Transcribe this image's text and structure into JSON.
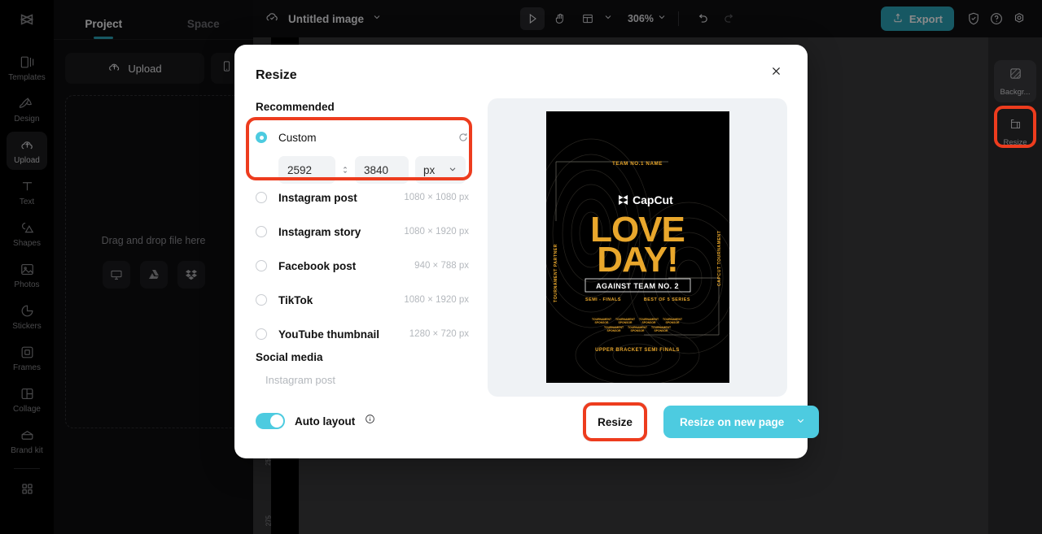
{
  "rail": {
    "logo": "capcut-logo",
    "items": [
      {
        "label": "Templates",
        "icon": "templates-icon",
        "active": false
      },
      {
        "label": "Design",
        "icon": "design-icon",
        "active": false
      },
      {
        "label": "Upload",
        "icon": "upload-cloud-icon",
        "active": true
      },
      {
        "label": "Text",
        "icon": "text-icon",
        "active": false
      },
      {
        "label": "Shapes",
        "icon": "shapes-icon",
        "active": false
      },
      {
        "label": "Photos",
        "icon": "photos-icon",
        "active": false
      },
      {
        "label": "Stickers",
        "icon": "stickers-icon",
        "active": false
      },
      {
        "label": "Frames",
        "icon": "frames-icon",
        "active": false
      },
      {
        "label": "Collage",
        "icon": "collage-icon",
        "active": false
      },
      {
        "label": "Brand kit",
        "icon": "brand-kit-icon",
        "active": false
      }
    ]
  },
  "panel": {
    "tabs": [
      {
        "label": "Project",
        "active": true
      },
      {
        "label": "Space",
        "active": false
      }
    ],
    "upload_label": "Upload",
    "dropzone_text": "Drag and drop file here",
    "sources": [
      "computer-icon",
      "google-drive-icon",
      "dropbox-icon"
    ]
  },
  "topbar": {
    "doc_title": "Untitled image",
    "zoom": "306%",
    "export_label": "Export",
    "tools": [
      "select-tool",
      "hand-tool",
      "layout-tool"
    ],
    "right_icons": [
      "shield-icon",
      "help-icon",
      "settings-icon"
    ]
  },
  "inspector": {
    "items": [
      {
        "label": "Backgr...",
        "icon": "background-icon"
      },
      {
        "label": "Resize",
        "icon": "resize-icon"
      }
    ]
  },
  "ruler": {
    "labels": [
      "25",
      "275"
    ]
  },
  "modal": {
    "title": "Resize",
    "close_icon": "close-icon",
    "recommended_label": "Recommended",
    "custom": {
      "label": "Custom",
      "selected": true,
      "width": "2592",
      "height": "3840",
      "unit": "px",
      "link_icon": "link-ratio-icon",
      "reset_icon": "reset-icon",
      "chevron_icon": "chevron-down-icon"
    },
    "presets": [
      {
        "label": "Instagram post",
        "size": "1080 × 1080 px",
        "selected": false
      },
      {
        "label": "Instagram story",
        "size": "1080 × 1920 px",
        "selected": false
      },
      {
        "label": "Facebook post",
        "size": "940 × 788 px",
        "selected": false
      },
      {
        "label": "TikTok",
        "size": "1080 × 1920 px",
        "selected": false
      },
      {
        "label": "YouTube thumbnail",
        "size": "1280 × 720 px",
        "selected": false
      }
    ],
    "social_media_label": "Social media",
    "social_media_item": "Instagram post",
    "auto_layout": {
      "label": "Auto layout",
      "on": true,
      "info_icon": "info-icon"
    },
    "buttons": {
      "resize": "Resize",
      "resize_new_page": "Resize on new page",
      "chevron_icon": "chevron-down-icon"
    }
  },
  "poster": {
    "top_label": "TEAM NO.1 NAME",
    "brand": "CapCut",
    "title_line1": "LOVE",
    "title_line2": "DAY!",
    "against": "AGAINST TEAM NO. 2",
    "semi": "SEMI - FINALS",
    "best_of": "BEST OF 5 SERIES",
    "left_vertical": "TOURNAMENT PARTNER",
    "right_vertical": "CAPCUT TOURNAMENT",
    "bottom_label": "UPPER BRACKET SEMI FINALS",
    "sponsor": "TOURNAMENT SPONSOR"
  },
  "colors": {
    "accent_teal": "#4DCBE0",
    "highlight_red": "#ED3C1E",
    "poster_gold": "#E9A72C",
    "preview_bg": "#EFF2F5"
  }
}
